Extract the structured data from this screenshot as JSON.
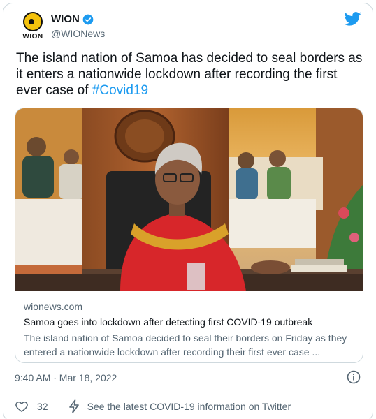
{
  "account": {
    "logo_text": "WION",
    "name": "WION",
    "handle": "@WIONews"
  },
  "tweet": {
    "text": "The island nation of Samoa has decided to seal borders as it enters a nationwide lockdown after recording the first ever case of ",
    "hashtag": "#Covid19"
  },
  "link_card": {
    "domain": "wionews.com",
    "title": "Samoa goes into lockdown after detecting first COVID-19 outbreak",
    "description": "The island nation of Samoa decided to seal their borders on Friday as they entered a nationwide lockdown after recording their first ever case ..."
  },
  "timestamp": "9:40 AM · Mar 18, 2022",
  "actions": {
    "like_count": "32",
    "covid_info": "See the latest COVID-19 information on Twitter"
  },
  "colors": {
    "accent": "#1d9bf0",
    "secondary_text": "#536471",
    "border": "#cfd9de"
  },
  "icons": [
    "verified-icon",
    "twitter-icon",
    "info-icon",
    "like-icon",
    "bolt-icon"
  ]
}
